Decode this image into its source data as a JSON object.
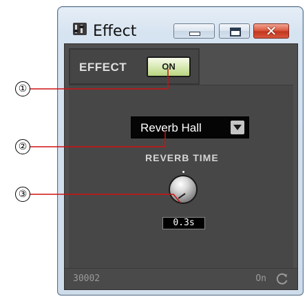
{
  "window": {
    "title": "Effect",
    "controls": {
      "close_symbol": "✕"
    }
  },
  "effect_panel": {
    "label": "EFFECT",
    "toggle_label": "ON"
  },
  "reverb": {
    "type_value": "Reverb Hall",
    "time_label": "REVERB TIME",
    "time_value": "0.3s"
  },
  "status_bar": {
    "device_id": "30002",
    "status": "On",
    "icon": "refresh-icon"
  },
  "callouts": [
    {
      "number": "①"
    },
    {
      "number": "②"
    },
    {
      "number": "③"
    }
  ],
  "colors": {
    "panel_bg": "#4f4f4f",
    "toggle_on": "#c8e19a",
    "leader_line": "#d01010"
  }
}
